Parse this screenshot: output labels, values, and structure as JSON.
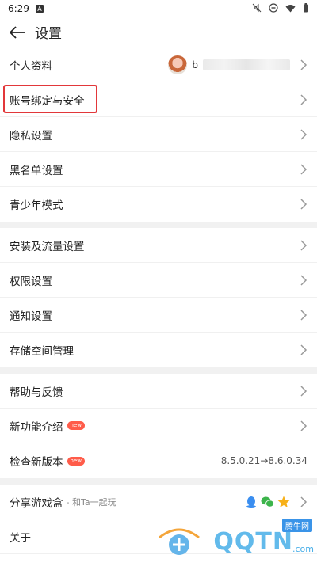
{
  "status_bar": {
    "time": "6:29",
    "a_icon_letter": "A"
  },
  "header": {
    "title": "设置"
  },
  "account": {
    "profile_label": "个人资料",
    "profile_name_visible": "b",
    "binding_label": "账号绑定与安全",
    "privacy_label": "隐私设置",
    "blacklist_label": "黑名单设置",
    "teen_label": "青少年模式"
  },
  "system": {
    "install_label": "安装及流量设置",
    "permission_label": "权限设置",
    "notify_label": "通知设置",
    "storage_label": "存储空间管理"
  },
  "about": {
    "help_label": "帮助与反馈",
    "features_label": "新功能介绍",
    "update_label": "检查新版本",
    "new_badge": "new",
    "version_text": "8.5.0.21→8.6.0.34"
  },
  "share": {
    "share_label": "分享游戏盒",
    "share_sub": "- 和Ta一起玩",
    "about_label": "关于"
  },
  "watermark": {
    "text": "QQTN",
    "suffix": ".com",
    "tag": "腾牛网"
  },
  "colors": {
    "highlight": "#e2373a",
    "badge": "#ff5c4a"
  }
}
